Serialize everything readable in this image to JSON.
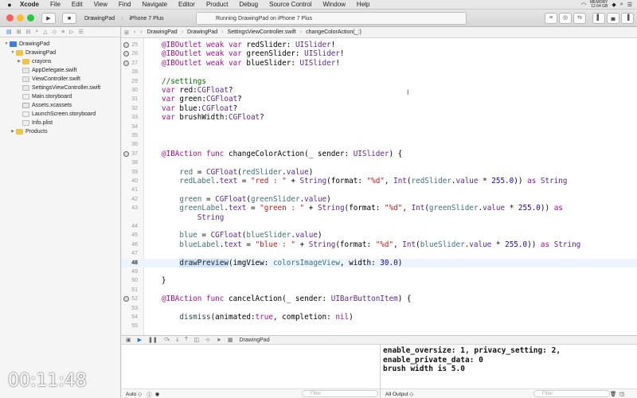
{
  "menubar": {
    "apple": "",
    "items": [
      "Xcode",
      "File",
      "Edit",
      "View",
      "Find",
      "Navigate",
      "Editor",
      "Product",
      "Debug",
      "Source Control",
      "Window",
      "Help"
    ],
    "memory_label": "MEMORY",
    "memory_value": "12.64 GB"
  },
  "toolbar": {
    "scheme": "DrawingPad",
    "device": "iPhone 7 Plus",
    "status": "Running DrawingPad on iPhone 7 Plus"
  },
  "jumpbar": [
    "DrawingPad",
    "DrawingPad",
    "SettingsViewController.swift",
    "changeColorAction(_:)"
  ],
  "navigator": {
    "tree": [
      {
        "label": "DrawingPad",
        "level": 0,
        "icon": "proj",
        "disc": "▼"
      },
      {
        "label": "DrawingPad",
        "level": 1,
        "icon": "folder",
        "disc": "▼"
      },
      {
        "label": "crayons",
        "level": 2,
        "icon": "folder",
        "disc": "▶"
      },
      {
        "label": "AppDelegate.swift",
        "level": 2,
        "icon": "swift",
        "disc": ""
      },
      {
        "label": "ViewController.swift",
        "level": 2,
        "icon": "swift",
        "disc": ""
      },
      {
        "label": "SettingsViewController.swift",
        "level": 2,
        "icon": "swift",
        "disc": ""
      },
      {
        "label": "Main.storyboard",
        "level": 2,
        "icon": "sb",
        "disc": ""
      },
      {
        "label": "Assets.xcassets",
        "level": 2,
        "icon": "asset",
        "disc": ""
      },
      {
        "label": "LaunchScreen.storyboard",
        "level": 2,
        "icon": "sb",
        "disc": ""
      },
      {
        "label": "Info.plist",
        "level": 2,
        "icon": "sb",
        "disc": ""
      },
      {
        "label": "Products",
        "level": 1,
        "icon": "folder",
        "disc": "▶"
      }
    ]
  },
  "code": [
    {
      "n": "25",
      "o": true,
      "t": [
        [
          "kw",
          "@IBOutlet weak var "
        ],
        [
          "pl",
          "redSlider: "
        ],
        [
          "ty",
          "UISlider"
        ],
        [
          "pl",
          "!"
        ]
      ]
    },
    {
      "n": "26",
      "o": true,
      "t": [
        [
          "kw",
          "@IBOutlet weak var "
        ],
        [
          "pl",
          "greenSlider: "
        ],
        [
          "ty",
          "UISlider"
        ],
        [
          "pl",
          "!"
        ]
      ]
    },
    {
      "n": "27",
      "o": true,
      "t": [
        [
          "kw",
          "@IBOutlet weak var "
        ],
        [
          "pl",
          "blueSlider: "
        ],
        [
          "ty",
          "UISlider"
        ],
        [
          "pl",
          "!"
        ]
      ]
    },
    {
      "n": "28",
      "t": []
    },
    {
      "n": "29",
      "t": [
        [
          "cm",
          "//settings"
        ]
      ]
    },
    {
      "n": "30",
      "t": [
        [
          "kw",
          "var "
        ],
        [
          "pl",
          "red:"
        ],
        [
          "ty",
          "CGFloat"
        ],
        [
          "pl",
          "?"
        ]
      ]
    },
    {
      "n": "31",
      "t": [
        [
          "kw",
          "var "
        ],
        [
          "pl",
          "green:"
        ],
        [
          "ty",
          "CGFloat"
        ],
        [
          "pl",
          "?"
        ]
      ]
    },
    {
      "n": "32",
      "t": [
        [
          "kw",
          "var "
        ],
        [
          "pl",
          "blue:"
        ],
        [
          "ty",
          "CGFloat"
        ],
        [
          "pl",
          "?"
        ]
      ]
    },
    {
      "n": "33",
      "t": [
        [
          "kw",
          "var "
        ],
        [
          "pl",
          "brushWidth:"
        ],
        [
          "ty",
          "CGFloat"
        ],
        [
          "pl",
          "?"
        ]
      ]
    },
    {
      "n": "34",
      "t": []
    },
    {
      "n": "35",
      "t": []
    },
    {
      "n": "36",
      "t": []
    },
    {
      "n": "37",
      "o": true,
      "t": [
        [
          "kw",
          "@IBAction func "
        ],
        [
          "pl",
          "changeColorAction(_ sender: "
        ],
        [
          "ty",
          "UISlider"
        ],
        [
          "pl",
          ") {"
        ]
      ]
    },
    {
      "n": "38",
      "t": []
    },
    {
      "n": "39",
      "t": [
        [
          "pl",
          "    "
        ],
        [
          "id",
          "red"
        ],
        [
          "pl",
          " = "
        ],
        [
          "ty",
          "CGFloat"
        ],
        [
          "pl",
          "("
        ],
        [
          "id",
          "redSlider"
        ],
        [
          "pl",
          "."
        ],
        [
          "ty",
          "value"
        ],
        [
          "pl",
          ")"
        ]
      ]
    },
    {
      "n": "40",
      "t": [
        [
          "pl",
          "    "
        ],
        [
          "id",
          "redLabel"
        ],
        [
          "pl",
          "."
        ],
        [
          "ty",
          "text"
        ],
        [
          "pl",
          " = "
        ],
        [
          "st",
          "\"red : \""
        ],
        [
          "pl",
          " + "
        ],
        [
          "ty",
          "String"
        ],
        [
          "pl",
          "(format: "
        ],
        [
          "st",
          "\"%d\""
        ],
        [
          "pl",
          ", "
        ],
        [
          "ty",
          "Int"
        ],
        [
          "pl",
          "("
        ],
        [
          "id",
          "redSlider"
        ],
        [
          "pl",
          "."
        ],
        [
          "ty",
          "value"
        ],
        [
          "pl",
          " * "
        ],
        [
          "nu",
          "255.0"
        ],
        [
          "pl",
          ")) "
        ],
        [
          "kw",
          "as "
        ],
        [
          "ty",
          "String"
        ]
      ]
    },
    {
      "n": "41",
      "t": []
    },
    {
      "n": "42",
      "t": [
        [
          "pl",
          "    "
        ],
        [
          "id",
          "green"
        ],
        [
          "pl",
          " = "
        ],
        [
          "ty",
          "CGFloat"
        ],
        [
          "pl",
          "("
        ],
        [
          "id",
          "greenSlider"
        ],
        [
          "pl",
          "."
        ],
        [
          "ty",
          "value"
        ],
        [
          "pl",
          ")"
        ]
      ]
    },
    {
      "n": "43",
      "t": [
        [
          "pl",
          "    "
        ],
        [
          "id",
          "greenLabel"
        ],
        [
          "pl",
          "."
        ],
        [
          "ty",
          "text"
        ],
        [
          "pl",
          " = "
        ],
        [
          "st",
          "\"green : \""
        ],
        [
          "pl",
          " + "
        ],
        [
          "ty",
          "String"
        ],
        [
          "pl",
          "(format: "
        ],
        [
          "st",
          "\"%d\""
        ],
        [
          "pl",
          ", "
        ],
        [
          "ty",
          "Int"
        ],
        [
          "pl",
          "("
        ],
        [
          "id",
          "greenSlider"
        ],
        [
          "pl",
          "."
        ],
        [
          "ty",
          "value"
        ],
        [
          "pl",
          " * "
        ],
        [
          "nu",
          "255.0"
        ],
        [
          "pl",
          ")) "
        ],
        [
          "kw",
          "as"
        ]
      ]
    },
    {
      "n": "",
      "t": [
        [
          "pl",
          "        "
        ],
        [
          "ty",
          "String"
        ]
      ]
    },
    {
      "n": "44",
      "t": []
    },
    {
      "n": "45",
      "t": [
        [
          "pl",
          "    "
        ],
        [
          "id",
          "blue"
        ],
        [
          "pl",
          " = "
        ],
        [
          "ty",
          "CGFloat"
        ],
        [
          "pl",
          "("
        ],
        [
          "id",
          "blueSlider"
        ],
        [
          "pl",
          "."
        ],
        [
          "ty",
          "value"
        ],
        [
          "pl",
          ")"
        ]
      ]
    },
    {
      "n": "46",
      "t": [
        [
          "pl",
          "    "
        ],
        [
          "id",
          "blueLabel"
        ],
        [
          "pl",
          "."
        ],
        [
          "ty",
          "text"
        ],
        [
          "pl",
          " = "
        ],
        [
          "st",
          "\"blue : \""
        ],
        [
          "pl",
          " + "
        ],
        [
          "ty",
          "String"
        ],
        [
          "pl",
          "(format: "
        ],
        [
          "st",
          "\"%d\""
        ],
        [
          "pl",
          ", "
        ],
        [
          "ty",
          "Int"
        ],
        [
          "pl",
          "("
        ],
        [
          "id",
          "blueSlider"
        ],
        [
          "pl",
          "."
        ],
        [
          "ty",
          "value"
        ],
        [
          "pl",
          " * "
        ],
        [
          "nu",
          "255.0"
        ],
        [
          "pl",
          ")) "
        ],
        [
          "kw",
          "as "
        ],
        [
          "ty",
          "String"
        ]
      ]
    },
    {
      "n": "47",
      "t": []
    },
    {
      "n": "48",
      "cur": true,
      "t": [
        [
          "pl",
          "    "
        ],
        [
          "hl",
          "drawPreview"
        ],
        [
          "pl",
          "(imgView: "
        ],
        [
          "id",
          "colorsImageView"
        ],
        [
          "pl",
          ", width: "
        ],
        [
          "nu",
          "30.0"
        ],
        [
          "pl",
          ")"
        ]
      ]
    },
    {
      "n": "49",
      "t": []
    },
    {
      "n": "50",
      "t": [
        [
          "pl",
          "}"
        ]
      ]
    },
    {
      "n": "51",
      "t": []
    },
    {
      "n": "52",
      "o": true,
      "t": [
        [
          "kw",
          "@IBAction func "
        ],
        [
          "pl",
          "cancelAction(_ sender: "
        ],
        [
          "ty",
          "UIBarButtonItem"
        ],
        [
          "pl",
          ") {"
        ]
      ]
    },
    {
      "n": "53",
      "t": []
    },
    {
      "n": "54",
      "t": [
        [
          "pl",
          "    "
        ],
        [
          "fn",
          "dismiss"
        ],
        [
          "pl",
          "(animated:"
        ],
        [
          "kw",
          "true"
        ],
        [
          "pl",
          ", completion: "
        ],
        [
          "kw",
          "nil"
        ],
        [
          "pl",
          ")"
        ]
      ]
    },
    {
      "n": "55",
      "t": []
    }
  ],
  "debug": {
    "target": "DrawingPad",
    "auto_label": "Auto ◇",
    "filter_placeholder": "Filter",
    "output_label": "All Output ◇"
  },
  "console": [
    "enable_oversize: 1, privacy_setting: 2,",
    "enable_private_data: 0",
    "brush width is 5.0"
  ],
  "timer": "00:11:48"
}
